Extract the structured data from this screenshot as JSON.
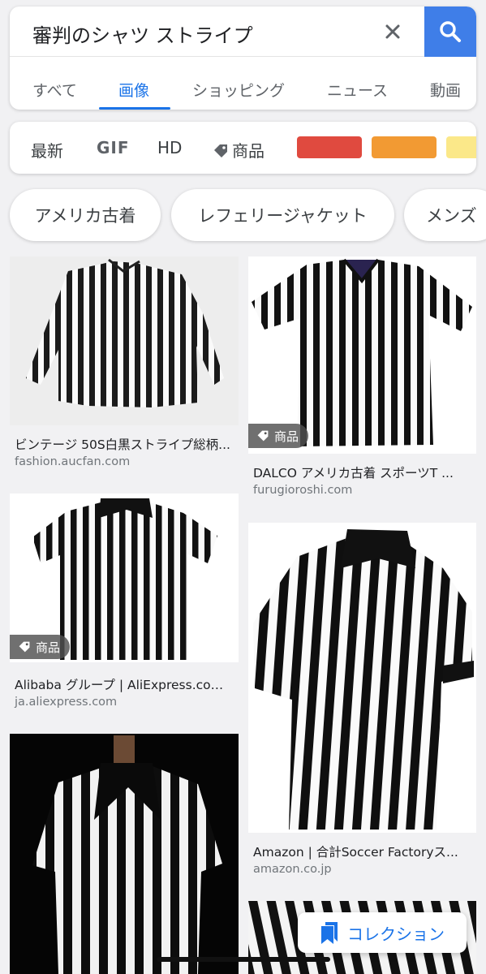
{
  "search": {
    "query": "審判のシャツ ストライプ",
    "tabs": [
      {
        "label": "すべて",
        "active": false
      },
      {
        "label": "画像",
        "active": true
      },
      {
        "label": "ショッピング",
        "active": false
      },
      {
        "label": "ニュース",
        "active": false
      },
      {
        "label": "動画",
        "active": false
      }
    ],
    "accent_color": "#3f7ee8"
  },
  "filters": {
    "items": [
      "最新",
      "GIF",
      "HD",
      "商品"
    ],
    "color_swatches": [
      "#e04a3f",
      "#f29a33",
      "#fbe889"
    ]
  },
  "chips": [
    "アメリカ古着",
    "レフェリージャケット",
    "メンズ"
  ],
  "results": [
    {
      "title": "ビンテージ 50S白黒ストライプ総柄...",
      "site": "fashion.aucfan.com",
      "badge": null
    },
    {
      "title": "DALCO アメリカ古着 スポーツT ...",
      "site": "furugioroshi.com",
      "badge": "商品"
    },
    {
      "title": "Alibaba グループ | AliExpress.com...",
      "site": "ja.aliexpress.com",
      "badge": "商品"
    },
    {
      "title": "Amazon | 合計Soccer Factoryス...",
      "site": "amazon.co.jp",
      "badge": null
    }
  ],
  "collection_button": {
    "label": "コレクション"
  }
}
